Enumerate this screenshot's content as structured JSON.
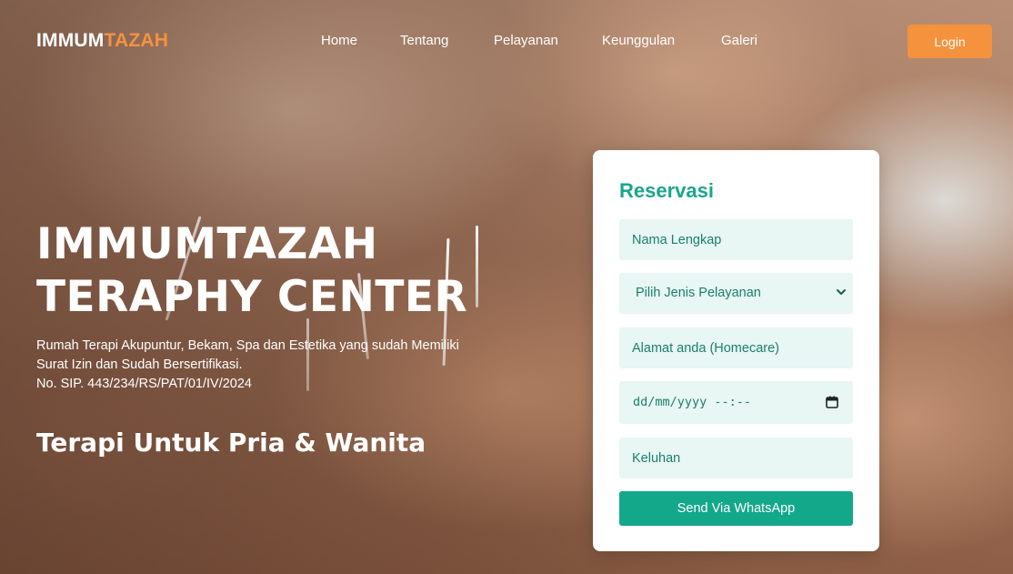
{
  "brand": {
    "part1": "IMMUM",
    "part2": "TAZAH"
  },
  "nav": {
    "links": [
      "Home",
      "Tentang",
      "Pelayanan",
      "Keunggulan",
      "Galeri"
    ],
    "login": "Login"
  },
  "hero": {
    "title_line1": "IMMUMTAZAH",
    "title_line2": "TERAPHY CENTER",
    "desc_line1": "Rumah Terapi Akupuntur, Bekam, Spa dan Estetika yang sudah Memiliki",
    "desc_line2": "Surat Izin dan Sudah Bersertifikasi.",
    "desc_line3": "No. SIP. 443/234/RS/PAT/01/IV/2024",
    "subtitle": "Terapi Untuk Pria & Wanita"
  },
  "reservation": {
    "title": "Reservasi",
    "name_placeholder": "Nama Lengkap",
    "service_selected": "Pilih Jenis Pelayanan",
    "address_placeholder": "Alamat anda (Homecare)",
    "datetime_placeholder": "dd/mm/yyyy --:--",
    "complaint_placeholder": "Keluhan",
    "submit_label": "Send Via WhatsApp"
  },
  "colors": {
    "accent_orange": "#f5923e",
    "accent_teal": "#14a88a",
    "field_bg": "#e8f6f4"
  },
  "icons": {
    "select": "chevron-down-icon",
    "date": "calendar-icon"
  }
}
